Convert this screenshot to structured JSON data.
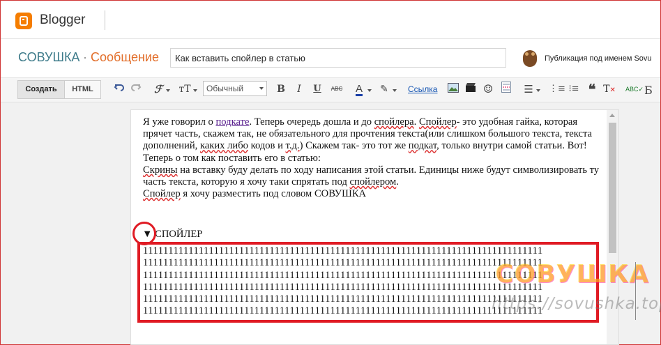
{
  "app": {
    "name": "Blogger"
  },
  "header": {
    "blog_name": "СОВУШКА",
    "separator": "·",
    "section": "Сообщение",
    "post_title": "Как вставить спойлер в статью",
    "published_as": "Публикация под именем Sovu"
  },
  "toolbar": {
    "compose_label": "Создать",
    "html_label": "HTML",
    "font_value": "Обычный",
    "link_label": "Ссылка",
    "icons": [
      "undo-icon",
      "redo-icon",
      "font-family-icon",
      "font-size-icon",
      "bold-icon",
      "italic-icon",
      "underline-icon",
      "strikethrough-icon",
      "text-color-icon",
      "highlight-icon",
      "link-icon",
      "image-icon",
      "video-icon",
      "emoji-icon",
      "jump-break-icon",
      "align-icon",
      "numbered-list-icon",
      "bulleted-list-icon",
      "quote-icon",
      "clear-format-icon",
      "spellcheck-icon"
    ],
    "right_edge_glyph": "Б"
  },
  "editor": {
    "p1_a": "Я уже говорил о ",
    "p1_link": "подкате",
    "p1_b": ". Теперь очередь дошла и до ",
    "p1_c": "спойлера",
    "p1_d": ". ",
    "p1_e": "Спойлер",
    "p1_f": "- это удобная гайка, которая прячет часть, скажем так, не обязательного для прочтения текста(или слишком большого текста, текста дополнений, ",
    "p1_g": "каких либо",
    "p1_h": " кодов и ",
    "p1_i": "т.д.",
    "p1_j": ") Скажем так- это тот же ",
    "p1_k": "подкат",
    "p1_l": ", только внутри самой статьи. Вот!",
    "p2": " Теперь о том как поставить его в статью:",
    "p3_a": "Скрины",
    "p3_b": " на вставку буду делать по ходу написания этой статьи. Единицы ниже будут символизировать ту часть текста, которую я хочу таки спрятать под ",
    "p3_c": "спойлером",
    "p3_d": ".",
    "p4_a": "Спойлер",
    "p4_b": " я хочу разместить под словом СОВУШКА",
    "spoiler_label": "▼ СПОЙЛЕР",
    "spoiler_lines": [
      "1111111111111111111111111111111111111111111111111111111111111111111111111111111",
      "1111111111111111111111111111111111111111111111111111111111111111111111111111111",
      "1111111111111111111111111111111111111111111111111111111111111111111111111111111",
      "1111111111111111111111111111111111111111111111111111111111111111111111111111111",
      "1111111111111111111111111111111111111111111111111111111111111111111111111111111",
      "1111111111111111111111111111111111111111111111111111111111111111111111111111111"
    ]
  },
  "watermark": {
    "title": "СОВУШКА",
    "url": "https://sovushka.top/"
  },
  "colors": {
    "accent_red": "#e01b24",
    "blogger_orange": "#f57d00",
    "blog_name": "#3e7b8a",
    "section": "#e26e2a",
    "link": "#1555b3"
  }
}
